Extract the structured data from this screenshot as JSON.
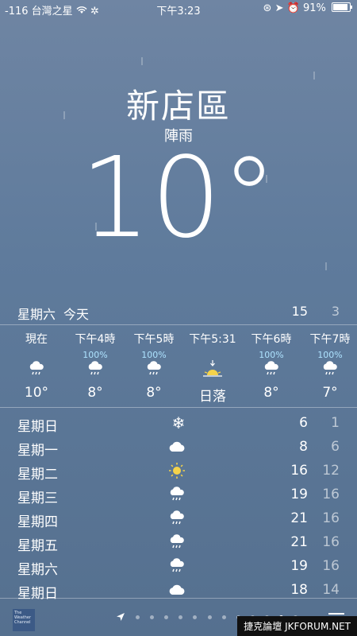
{
  "status": {
    "signal": "-116",
    "carrier": "台灣之星",
    "time": "下午3:23",
    "battery": "91%"
  },
  "location": {
    "city": "新店區",
    "condition": "陣雨",
    "temperature": "10°"
  },
  "today": {
    "day": "星期六",
    "label": "今天",
    "hi": "15",
    "lo": "3"
  },
  "hourly": [
    {
      "time": "現在",
      "prob": "",
      "icon": "rain-cloud-icon",
      "temp": "10°"
    },
    {
      "time": "下午4時",
      "prob": "100%",
      "icon": "rain-cloud-icon",
      "temp": "8°"
    },
    {
      "time": "下午5時",
      "prob": "100%",
      "icon": "rain-cloud-icon",
      "temp": "8°"
    },
    {
      "time": "下午5:31",
      "prob": "",
      "icon": "sunset-icon",
      "temp": "日落"
    },
    {
      "time": "下午6時",
      "prob": "100%",
      "icon": "rain-cloud-icon",
      "temp": "8°"
    },
    {
      "time": "下午7時",
      "prob": "100%",
      "icon": "rain-cloud-icon",
      "temp": "7°"
    }
  ],
  "daily": [
    {
      "name": "星期日",
      "icon": "snowflake-icon",
      "hi": "6",
      "lo": "1"
    },
    {
      "name": "星期一",
      "icon": "cloud-icon",
      "hi": "8",
      "lo": "6"
    },
    {
      "name": "星期二",
      "icon": "sun-icon",
      "hi": "16",
      "lo": "12"
    },
    {
      "name": "星期三",
      "icon": "rain-cloud-icon",
      "hi": "19",
      "lo": "16"
    },
    {
      "name": "星期四",
      "icon": "rain-cloud-icon",
      "hi": "21",
      "lo": "16"
    },
    {
      "name": "星期五",
      "icon": "rain-cloud-icon",
      "hi": "21",
      "lo": "16"
    },
    {
      "name": "星期六",
      "icon": "rain-cloud-icon",
      "hi": "19",
      "lo": "16"
    },
    {
      "name": "星期日",
      "icon": "cloud-icon",
      "hi": "18",
      "lo": "14"
    }
  ],
  "footer": {
    "logo_text": "The Weather Channel",
    "watermark": "捷克論壇 JKFORUM.NET"
  },
  "colors": {
    "background": "#5f7b9c",
    "precip_prob": "#aee3ff",
    "sun": "#f5d34a"
  }
}
